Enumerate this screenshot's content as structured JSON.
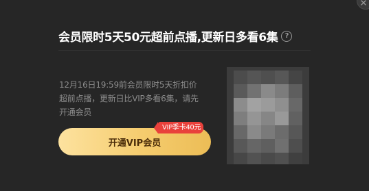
{
  "dialog": {
    "title": "会员限时5天50元超前点播,更新日多看6集",
    "help_icon": "?",
    "description": "12月16日19:59前会员限时5天折扣价超前点播，更新日比VIP多看6集，请先开通会员",
    "open_vip_button_label": "开通VIP会员",
    "badge_label": "VIP季卡40元",
    "cover_alt": "pixelated-cover-image"
  },
  "icons": {
    "close": "close-icon",
    "help": "question-circle-icon"
  },
  "colors": {
    "background": "#262626",
    "title": "#ffffff",
    "description": "#8c8c8c",
    "button_gradient_start": "#fde29f",
    "button_gradient_end": "#ecbd56",
    "button_text": "#4b2d09",
    "badge": "#e9413b"
  }
}
